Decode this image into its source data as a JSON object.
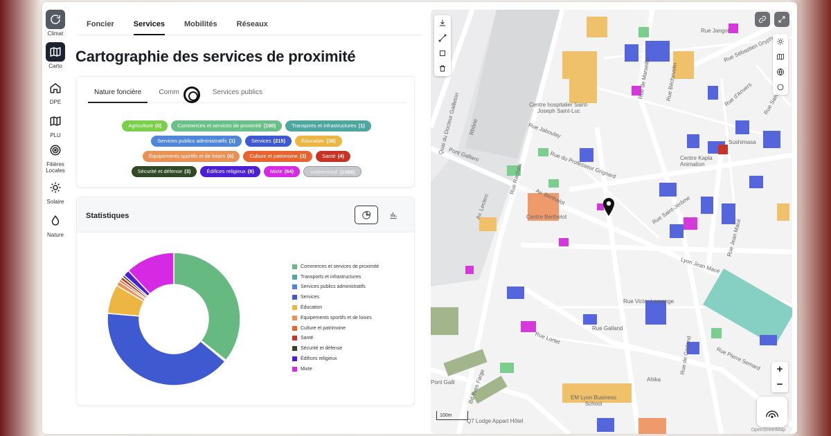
{
  "rail": [
    {
      "label": "Climat",
      "icon": "refresh-icon"
    },
    {
      "label": "Carto",
      "icon": "map-icon"
    },
    {
      "label": "DPE",
      "icon": "home-icon"
    },
    {
      "label": "PLU",
      "icon": "map-fold-icon"
    },
    {
      "label": "Filières Locales",
      "icon": "target-icon"
    },
    {
      "label": "Solaire",
      "icon": "sun-icon"
    },
    {
      "label": "Nature",
      "icon": "drop-icon"
    }
  ],
  "top_tabs": [
    "Foncier",
    "Services",
    "Mobilités",
    "Réseaux"
  ],
  "page_title": "Cartographie des services de proximité",
  "sub_tabs": [
    "Nature foncière",
    "Comm",
    "Services publics"
  ],
  "tags": [
    [
      {
        "label": "Agriculture",
        "count": "(0)",
        "color": "#7ccf4a"
      },
      {
        "label": "Commerces et services de proximité",
        "count": "(190)",
        "color": "#6bbf88"
      },
      {
        "label": "Transports et infrastructures",
        "count": "(1)",
        "color": "#4ea6a1"
      }
    ],
    [
      {
        "label": "Services publics administratifs",
        "count": "(1)",
        "color": "#4f86d9"
      },
      {
        "label": "Services",
        "count": "(215)",
        "color": "#3f59d1"
      },
      {
        "label": "Éducation",
        "count": "(38)",
        "color": "#edb542"
      }
    ],
    [
      {
        "label": "Équipements sportifs et de loisirs",
        "count": "(6)",
        "color": "#ea9155"
      },
      {
        "label": "Culture et patrimoine",
        "count": "(3)",
        "color": "#e8632e"
      },
      {
        "label": "Santé",
        "count": "(4)",
        "color": "#c73425"
      }
    ],
    [
      {
        "label": "Sécurité et défense",
        "count": "(3)",
        "color": "#2f4a24"
      },
      {
        "label": "Édifices religieux",
        "count": "(8)",
        "color": "#4c1fd4"
      },
      {
        "label": "Mixte",
        "count": "(64)",
        "color": "#d629e3"
      },
      {
        "label": "Indéterminé",
        "count": "(1488)",
        "color": "#c6c8cc"
      }
    ]
  ],
  "stats_title": "Statistiques",
  "chart_data": {
    "type": "pie",
    "donut": true,
    "categories": [
      "Commerces et services de proximité",
      "Transports et infrastructures",
      "Services publics administratifs",
      "Services",
      "Éducation",
      "Equipements sportifs et de loisirs",
      "Culture et patrimoine",
      "Santé",
      "Sécurité et défense",
      "Édifices religieux",
      "Mixte"
    ],
    "values": [
      190,
      1,
      1,
      215,
      38,
      6,
      3,
      4,
      3,
      8,
      64
    ],
    "colors": [
      "#66b981",
      "#4fa8a4",
      "#4f86d9",
      "#3f59d1",
      "#edb542",
      "#ea9155",
      "#e8632e",
      "#c73425",
      "#2f4a24",
      "#4c1fd4",
      "#d629e3"
    ],
    "legend_position": "right"
  },
  "map": {
    "labels": [
      {
        "text": "Rue Jangot"
      },
      {
        "text": "Rue Sébastien Gryphe"
      },
      {
        "text": "Rue de Marseille"
      },
      {
        "text": "Rue Béchevelin"
      },
      {
        "text": "Rue d'Anvers"
      },
      {
        "text": "Rue Saint-Michel"
      },
      {
        "text": "Centre hospitalier Saint-Joseph Saint-Luc"
      },
      {
        "text": "Rue Jaboulay"
      },
      {
        "text": "Quai du Docteur Gailleton"
      },
      {
        "text": "Rhône"
      },
      {
        "text": "Pont Gallieni"
      },
      {
        "text": "Rue Rachais"
      },
      {
        "text": "Rue du Professeur Grignard"
      },
      {
        "text": "Centre Kapla Animation"
      },
      {
        "text": "Sushimasa"
      },
      {
        "text": "Av. Leclerc"
      },
      {
        "text": "Av. Berthelot"
      },
      {
        "text": "Centre Berthelot"
      },
      {
        "text": "Rue Saint-Jérôme"
      },
      {
        "text": "Rue Jean Macé"
      },
      {
        "text": "Lyon Jean Macé"
      },
      {
        "text": "Rue Victor Lagrange"
      },
      {
        "text": "Rue Galland"
      },
      {
        "text": "Rue Lortet"
      },
      {
        "text": "Rue de Gerland"
      },
      {
        "text": "Rue Pierre Semard"
      },
      {
        "text": "Ahika"
      },
      {
        "text": "Bd Yves Farge"
      },
      {
        "text": "EM Lyon Business School"
      },
      {
        "text": "Q7 Lodge Appart Hôtel"
      },
      {
        "text": "Pont Galli"
      }
    ],
    "scale": "100m",
    "attribution": "OpenStreetMap",
    "zoom_in": "+",
    "zoom_out": "−"
  }
}
